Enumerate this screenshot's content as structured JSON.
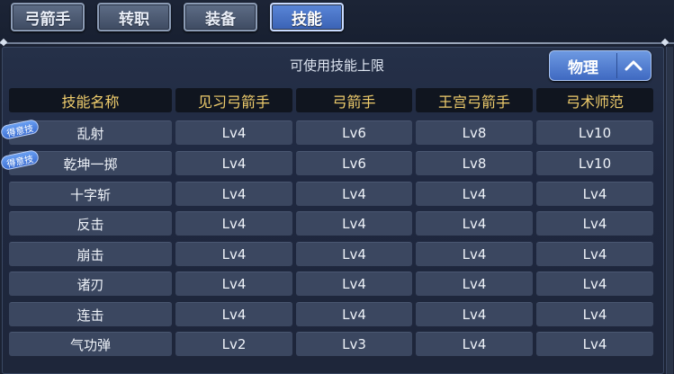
{
  "tabs": [
    {
      "label": "弓箭手"
    },
    {
      "label": "转职"
    },
    {
      "label": "装备"
    },
    {
      "label": "技能"
    }
  ],
  "caption": "可使用技能上限",
  "dropdown": {
    "selected": "物理"
  },
  "badge_label": "得意技",
  "table": {
    "headers": [
      "技能名称",
      "见习弓箭手",
      "弓箭手",
      "王宫弓箭手",
      "弓术师范"
    ],
    "rows": [
      {
        "name": "乱射",
        "badge": true,
        "levels": [
          "Lv4",
          "Lv6",
          "Lv8",
          "Lv10"
        ]
      },
      {
        "name": "乾坤一掷",
        "badge": true,
        "levels": [
          "Lv4",
          "Lv6",
          "Lv8",
          "Lv10"
        ]
      },
      {
        "name": "十字斩",
        "badge": false,
        "levels": [
          "Lv4",
          "Lv4",
          "Lv4",
          "Lv4"
        ]
      },
      {
        "name": "反击",
        "badge": false,
        "levels": [
          "Lv4",
          "Lv4",
          "Lv4",
          "Lv4"
        ]
      },
      {
        "name": "崩击",
        "badge": false,
        "levels": [
          "Lv4",
          "Lv4",
          "Lv4",
          "Lv4"
        ]
      },
      {
        "name": "诸刃",
        "badge": false,
        "levels": [
          "Lv4",
          "Lv4",
          "Lv4",
          "Lv4"
        ]
      },
      {
        "name": "连击",
        "badge": false,
        "levels": [
          "Lv4",
          "Lv4",
          "Lv4",
          "Lv4"
        ]
      },
      {
        "name": "气功弹",
        "badge": false,
        "levels": [
          "Lv2",
          "Lv3",
          "Lv4",
          "Lv4"
        ]
      }
    ]
  }
}
